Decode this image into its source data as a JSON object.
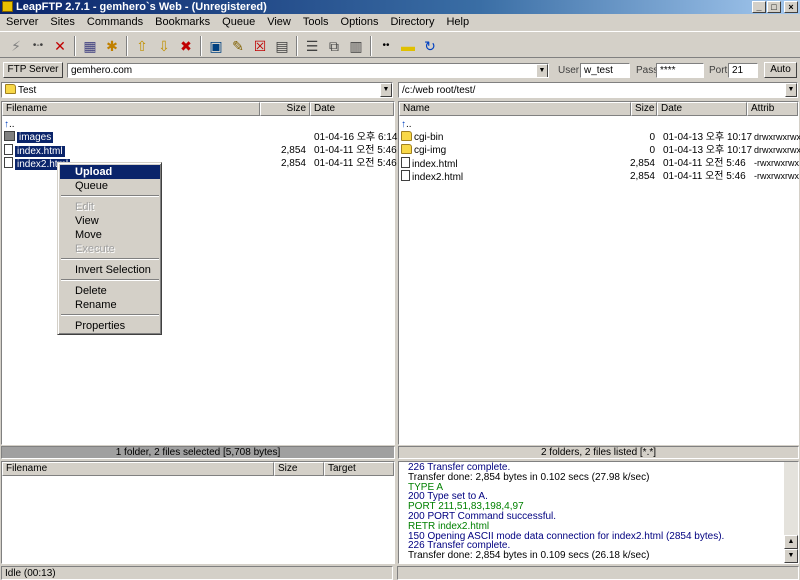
{
  "window": {
    "title": "LeapFTP 2.7.1 - gemhero`s Web - (Unregistered)"
  },
  "menu": [
    "Server",
    "Sites",
    "Commands",
    "Bookmarks",
    "Queue",
    "View",
    "Tools",
    "Options",
    "Directory",
    "Help"
  ],
  "connection": {
    "button_label": "FTP Server",
    "server_value": "gemhero.com",
    "user_label": "User",
    "user_value": "w_test",
    "pass_label": "Pass",
    "pass_value": "****",
    "port_label": "Port",
    "port_value": "21",
    "auto_label": "Auto"
  },
  "local": {
    "path": "Test",
    "columns": [
      "Filename",
      "Size",
      "Date"
    ],
    "up_label": "..",
    "files": [
      {
        "name": "images",
        "size": "",
        "date": "01-04-16 오후 6:14",
        "type": "folder"
      },
      {
        "name": "index.html",
        "size": "2,854",
        "date": "01-04-11 오전 5:46",
        "type": "file"
      },
      {
        "name": "index2.html",
        "size": "2,854",
        "date": "01-04-11 오전 5:46",
        "type": "file"
      }
    ],
    "status": "1 folder, 2 files selected [5,708 bytes]"
  },
  "remote": {
    "path": "/c:/web root/test/",
    "columns": [
      "Name",
      "Size",
      "Date",
      "Attrib"
    ],
    "up_label": "..",
    "files": [
      {
        "name": "cgi-bin",
        "size": "0",
        "date": "01-04-13 오후 10:17",
        "attrib": "drwxrwxrwx",
        "type": "folder"
      },
      {
        "name": "cgi-img",
        "size": "0",
        "date": "01-04-13 오후 10:17",
        "attrib": "drwxrwxrwx",
        "type": "folder"
      },
      {
        "name": "index.html",
        "size": "2,854",
        "date": "01-04-11 오전 5:46",
        "attrib": "-rwxrwxrwx",
        "type": "file"
      },
      {
        "name": "index2.html",
        "size": "2,854",
        "date": "01-04-11 오전 5:46",
        "attrib": "-rwxrwxrwx",
        "type": "file"
      }
    ],
    "status": "2 folders, 2 files listed [*.*]"
  },
  "context_menu": {
    "upload": "Upload",
    "queue": "Queue",
    "edit": "Edit",
    "view": "View",
    "move": "Move",
    "execute": "Execute",
    "invert": "Invert Selection",
    "delete": "Delete",
    "rename": "Rename",
    "properties": "Properties"
  },
  "queue": {
    "columns": [
      "Filename",
      "Size",
      "Target"
    ]
  },
  "log": [
    {
      "text": "226 Transfer complete.",
      "color": "#000080"
    },
    {
      "text": "Transfer done: 2,854 bytes in 0.102 secs (27.98 k/sec)",
      "color": "#000000"
    },
    {
      "text": "TYPE A",
      "color": "#008000"
    },
    {
      "text": "200 Type set to A.",
      "color": "#000080"
    },
    {
      "text": "PORT 211,51,83,198,4,97",
      "color": "#008000"
    },
    {
      "text": "200 PORT Command successful.",
      "color": "#000080"
    },
    {
      "text": "RETR index2.html",
      "color": "#008000"
    },
    {
      "text": "150 Opening ASCII mode data connection for index2.html (2854 bytes).",
      "color": "#000080"
    },
    {
      "text": "226 Transfer complete.",
      "color": "#000080"
    },
    {
      "text": "Transfer done: 2,854 bytes in 0.109 secs (26.18 k/sec)",
      "color": "#000000"
    }
  ],
  "statusbar": {
    "left": "Idle (00:13)"
  }
}
